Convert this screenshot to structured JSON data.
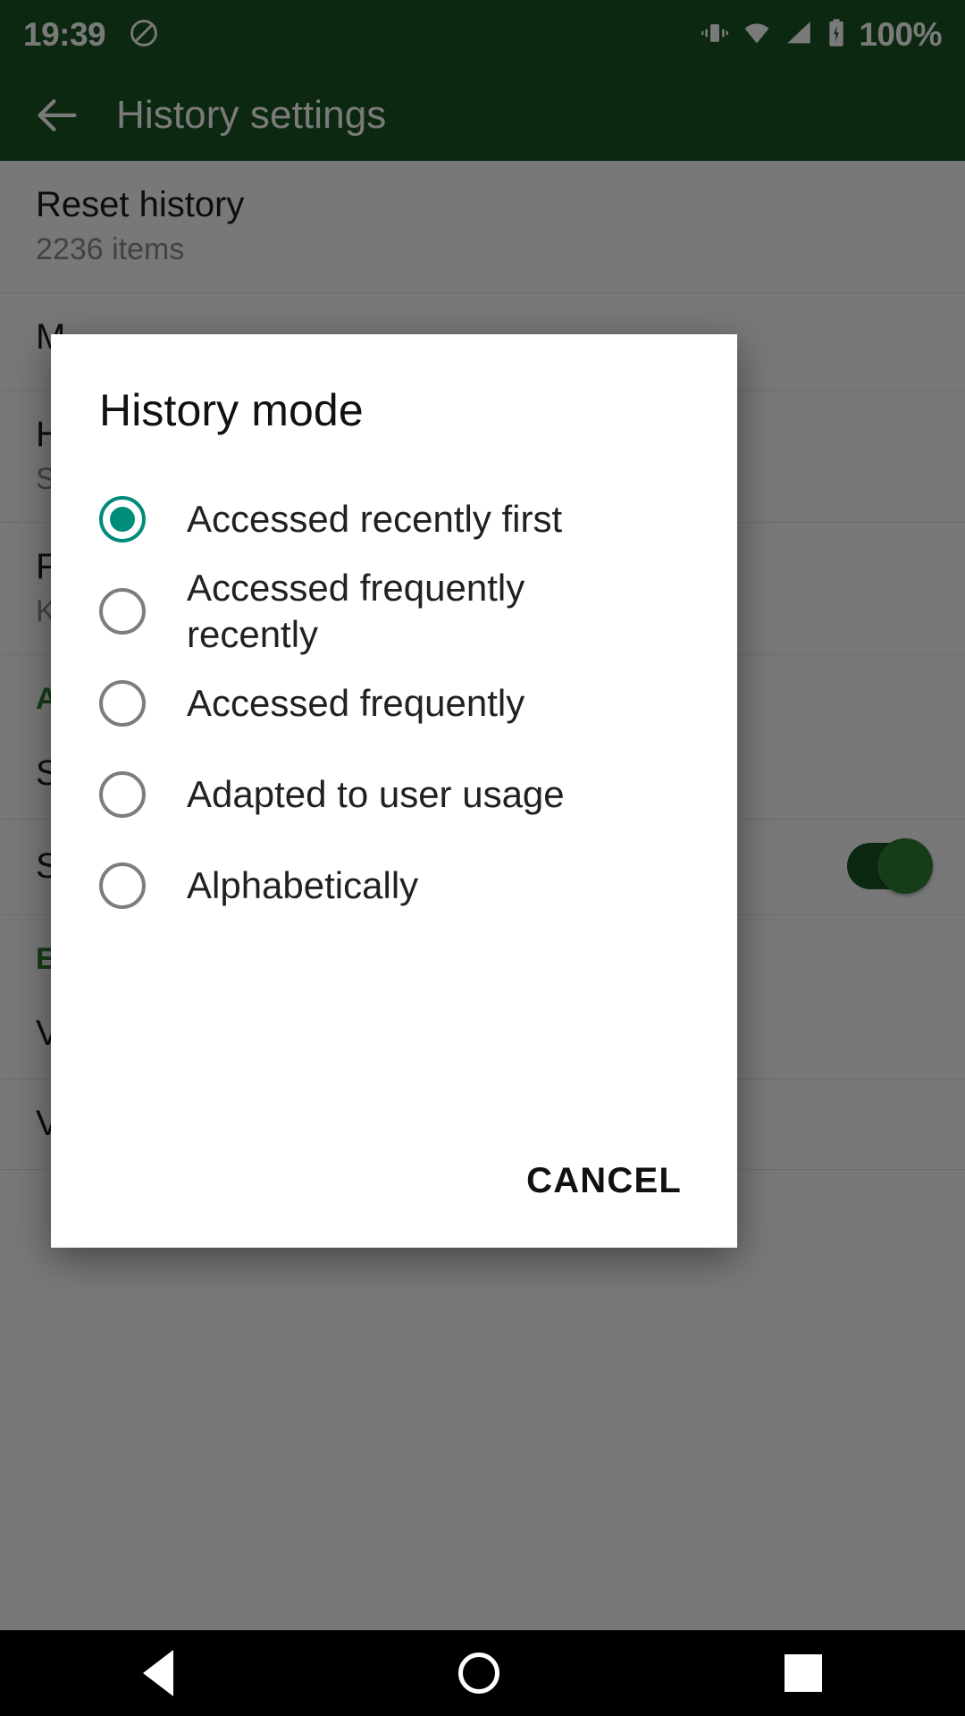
{
  "status_bar": {
    "time": "19:39",
    "battery_percent": "100%",
    "icons": [
      "no-sound-icon",
      "vibrate-icon",
      "wifi-icon",
      "signal-icon",
      "battery-icon"
    ]
  },
  "toolbar": {
    "back_label": "back-arrow-icon",
    "title": "History settings"
  },
  "settings_rows": [
    {
      "title": "Reset history",
      "subtitle": "2236 items"
    },
    {
      "title": "M",
      "subtitle": ""
    },
    {
      "title": "H",
      "subtitle": "S"
    },
    {
      "title": "F",
      "subtitle": "K"
    }
  ],
  "section_a_header": "A",
  "section_a_rows": [
    {
      "title": "S",
      "subtitle": ""
    },
    {
      "title": "S",
      "subtitle": "",
      "toggle": true
    }
  ],
  "excluded_section": {
    "header": "Excluded apps",
    "rows": [
      {
        "title": "View or edit apps excluded from KISS"
      },
      {
        "title": "View or edit apps excluded from history"
      }
    ]
  },
  "dialog": {
    "title": "History mode",
    "options": [
      {
        "label": "Accessed recently first",
        "selected": true
      },
      {
        "label": "Accessed frequently recently",
        "selected": false
      },
      {
        "label": "Accessed frequently",
        "selected": false
      },
      {
        "label": "Adapted to user usage",
        "selected": false
      },
      {
        "label": "Alphabetically",
        "selected": false
      }
    ],
    "cancel_label": "CANCEL",
    "accent_color": "#008c7a",
    "unselected_color": "#7d7d7d"
  },
  "nav_bar": {
    "back": "nav-back-icon",
    "home": "nav-home-icon",
    "recents": "nav-recents-icon"
  },
  "colors": {
    "toolbar_green": "#1B5524",
    "section_green": "#2e7d32",
    "teal_accent": "#008c7a"
  }
}
